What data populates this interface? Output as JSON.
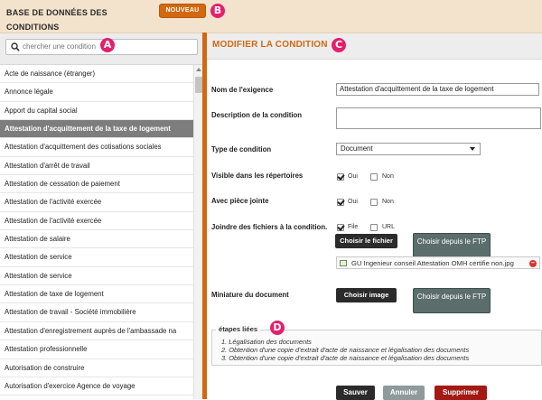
{
  "header": {
    "app_title": "BASE DE DONNÉES DES CONDITIONS",
    "new_button": "NOUVEAU",
    "marker": "B"
  },
  "sidebar": {
    "search_placeholder": "chercher une condition",
    "marker": "A",
    "items": [
      {
        "label": "Acte de naissance (étranger)",
        "active": false
      },
      {
        "label": "Annonce légale",
        "active": false
      },
      {
        "label": "Apport du capital social",
        "active": false
      },
      {
        "label": "Attestation d'acquittement de la taxe de logement",
        "active": true
      },
      {
        "label": "Attestation d'acquittement des cotisations sociales",
        "active": false
      },
      {
        "label": "Attestation d'arrêt de travail",
        "active": false
      },
      {
        "label": "Attestation de cessation de paiement",
        "active": false
      },
      {
        "label": "Attestation de l'activité exercée",
        "active": false
      },
      {
        "label": "Attestation de l'activité exercée",
        "active": false
      },
      {
        "label": "Attestation de salaire",
        "active": false
      },
      {
        "label": "Attestation de service",
        "active": false
      },
      {
        "label": "Attestation de service",
        "active": false
      },
      {
        "label": "Attestation de taxe de logement",
        "active": false
      },
      {
        "label": "Attestation de travail - Société immobilière",
        "active": false
      },
      {
        "label": "Attestation d'enregistrement auprès de l'ambassade na",
        "active": false
      },
      {
        "label": "Attestation professionnelle",
        "active": false
      },
      {
        "label": "Autorisation de construire",
        "active": false
      },
      {
        "label": "Autorisation d'exercice Agence de voyage",
        "active": false
      }
    ]
  },
  "main": {
    "title": "MODIFIER LA CONDITION",
    "marker": "C",
    "requirement_name_label": "Nom de l'exigence",
    "requirement_name_value": "Attestation d'acquittement de la taxe de logement",
    "description_label": "Description de la condition",
    "description_value": "",
    "condition_type_label": "Type de condition",
    "condition_type_value": "Document",
    "visible_label": "Visible dans les répertoires",
    "attachment_label": "Avec pièce jointe",
    "oui": "Oui",
    "non": "Non",
    "attach_files_label": "Joindre des fichiers à la condition.",
    "file_label": "File",
    "url_label": "URL",
    "choose_file_button": "Choisir le fichier",
    "ftp_button": "Choisir depuis le FTP",
    "attached_file": "GU Ingenieur conseil Attestation OMH certifie non.jpg",
    "thumbnail_label": "Miniature du document",
    "choose_image_button": "Choisir image",
    "steps": {
      "legend": "étapes liées",
      "marker": "D",
      "items": [
        "1. Légalisation des documents",
        "2. Obtention d'une copie d'extrait d'acte de naissance et légalisation des documents",
        "3. Obtention d'une copie d'extrait d'acte de naissance et légalisation des documents"
      ]
    },
    "save_button": "Sauver",
    "cancel_button": "Annuler",
    "delete_button": "Supprimer"
  },
  "colors": {
    "accent": "#d2680f",
    "header_bg": "#f4e3cc",
    "active_item": "#7d7d7d",
    "delete": "#a31a14",
    "marker": "#e2206c"
  }
}
